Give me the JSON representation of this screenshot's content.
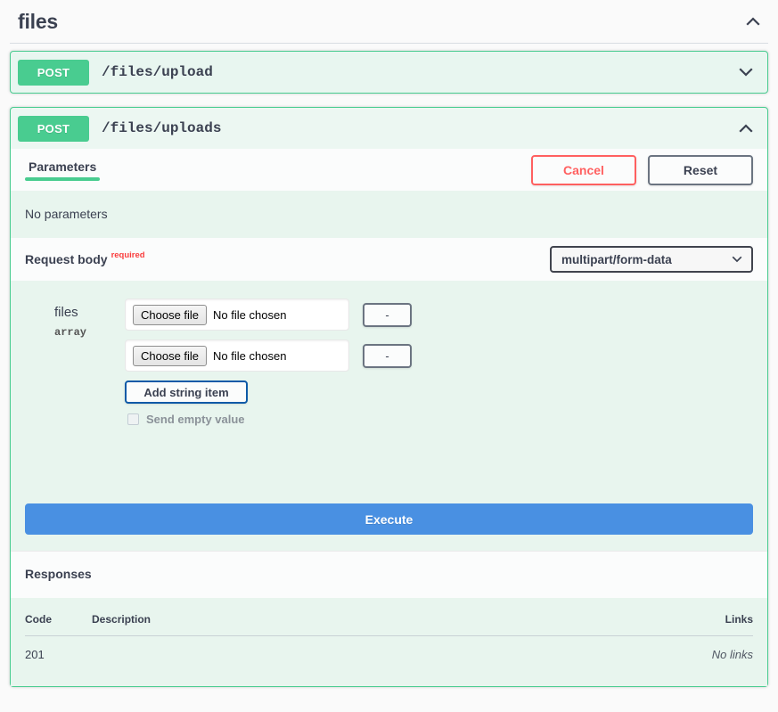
{
  "tag": {
    "name": "files",
    "collapse_icon": "chevron-up-icon"
  },
  "operations": [
    {
      "method": "POST",
      "path": "/files/upload",
      "expanded": false,
      "caret_icon": "chevron-down-icon"
    },
    {
      "method": "POST",
      "path": "/files/uploads",
      "expanded": true,
      "caret_icon": "chevron-up-icon"
    }
  ],
  "operation_detail": {
    "tabs": [
      {
        "label": "Parameters",
        "active": true
      }
    ],
    "buttons": {
      "cancel_label": "Cancel",
      "reset_label": "Reset"
    },
    "no_parameters_text": "No parameters",
    "request_body": {
      "label": "Request body",
      "required_label": "required",
      "content_type_selected": "multipart/form-data",
      "content_type_caret_icon": "chevron-down-icon"
    },
    "body_param": {
      "name": "files",
      "type": "array",
      "file_rows": [
        {
          "choose_label": "Choose file",
          "file_status": "No file chosen",
          "remove_label": "-"
        },
        {
          "choose_label": "Choose file",
          "file_status": "No file chosen",
          "remove_label": "-"
        }
      ],
      "add_item_label": "Add string item",
      "send_empty_label": "Send empty value",
      "send_empty_checked": false
    },
    "execute_label": "Execute",
    "responses": {
      "title": "Responses",
      "columns": {
        "code": "Code",
        "description": "Description",
        "links": "Links"
      },
      "rows": [
        {
          "code": "201",
          "description": "",
          "links": "No links"
        }
      ]
    }
  },
  "colors": {
    "method_post": "#49cc90",
    "execute": "#4990e2",
    "required": "#f93e3e",
    "cancel": "#ff6060",
    "add_item_border": "#0d5aa7",
    "tint": "#e8f5ee"
  }
}
